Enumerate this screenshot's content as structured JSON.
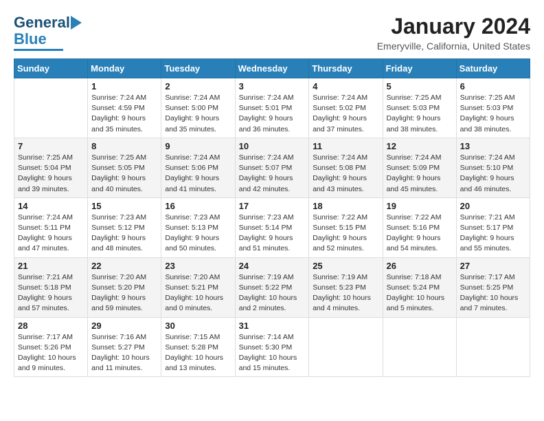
{
  "header": {
    "logo": {
      "general": "General",
      "blue": "Blue",
      "underline_color": "#2980b9"
    },
    "title": "January 2024",
    "location": "Emeryville, California, United States"
  },
  "calendar": {
    "days_of_week": [
      "Sunday",
      "Monday",
      "Tuesday",
      "Wednesday",
      "Thursday",
      "Friday",
      "Saturday"
    ],
    "weeks": [
      [
        {
          "day": "",
          "info": ""
        },
        {
          "day": "1",
          "info": "Sunrise: 7:24 AM\nSunset: 4:59 PM\nDaylight: 9 hours\nand 35 minutes."
        },
        {
          "day": "2",
          "info": "Sunrise: 7:24 AM\nSunset: 5:00 PM\nDaylight: 9 hours\nand 35 minutes."
        },
        {
          "day": "3",
          "info": "Sunrise: 7:24 AM\nSunset: 5:01 PM\nDaylight: 9 hours\nand 36 minutes."
        },
        {
          "day": "4",
          "info": "Sunrise: 7:24 AM\nSunset: 5:02 PM\nDaylight: 9 hours\nand 37 minutes."
        },
        {
          "day": "5",
          "info": "Sunrise: 7:25 AM\nSunset: 5:03 PM\nDaylight: 9 hours\nand 38 minutes."
        },
        {
          "day": "6",
          "info": "Sunrise: 7:25 AM\nSunset: 5:03 PM\nDaylight: 9 hours\nand 38 minutes."
        }
      ],
      [
        {
          "day": "7",
          "info": "Sunrise: 7:25 AM\nSunset: 5:04 PM\nDaylight: 9 hours\nand 39 minutes."
        },
        {
          "day": "8",
          "info": "Sunrise: 7:25 AM\nSunset: 5:05 PM\nDaylight: 9 hours\nand 40 minutes."
        },
        {
          "day": "9",
          "info": "Sunrise: 7:24 AM\nSunset: 5:06 PM\nDaylight: 9 hours\nand 41 minutes."
        },
        {
          "day": "10",
          "info": "Sunrise: 7:24 AM\nSunset: 5:07 PM\nDaylight: 9 hours\nand 42 minutes."
        },
        {
          "day": "11",
          "info": "Sunrise: 7:24 AM\nSunset: 5:08 PM\nDaylight: 9 hours\nand 43 minutes."
        },
        {
          "day": "12",
          "info": "Sunrise: 7:24 AM\nSunset: 5:09 PM\nDaylight: 9 hours\nand 45 minutes."
        },
        {
          "day": "13",
          "info": "Sunrise: 7:24 AM\nSunset: 5:10 PM\nDaylight: 9 hours\nand 46 minutes."
        }
      ],
      [
        {
          "day": "14",
          "info": "Sunrise: 7:24 AM\nSunset: 5:11 PM\nDaylight: 9 hours\nand 47 minutes."
        },
        {
          "day": "15",
          "info": "Sunrise: 7:23 AM\nSunset: 5:12 PM\nDaylight: 9 hours\nand 48 minutes."
        },
        {
          "day": "16",
          "info": "Sunrise: 7:23 AM\nSunset: 5:13 PM\nDaylight: 9 hours\nand 50 minutes."
        },
        {
          "day": "17",
          "info": "Sunrise: 7:23 AM\nSunset: 5:14 PM\nDaylight: 9 hours\nand 51 minutes."
        },
        {
          "day": "18",
          "info": "Sunrise: 7:22 AM\nSunset: 5:15 PM\nDaylight: 9 hours\nand 52 minutes."
        },
        {
          "day": "19",
          "info": "Sunrise: 7:22 AM\nSunset: 5:16 PM\nDaylight: 9 hours\nand 54 minutes."
        },
        {
          "day": "20",
          "info": "Sunrise: 7:21 AM\nSunset: 5:17 PM\nDaylight: 9 hours\nand 55 minutes."
        }
      ],
      [
        {
          "day": "21",
          "info": "Sunrise: 7:21 AM\nSunset: 5:18 PM\nDaylight: 9 hours\nand 57 minutes."
        },
        {
          "day": "22",
          "info": "Sunrise: 7:20 AM\nSunset: 5:20 PM\nDaylight: 9 hours\nand 59 minutes."
        },
        {
          "day": "23",
          "info": "Sunrise: 7:20 AM\nSunset: 5:21 PM\nDaylight: 10 hours\nand 0 minutes."
        },
        {
          "day": "24",
          "info": "Sunrise: 7:19 AM\nSunset: 5:22 PM\nDaylight: 10 hours\nand 2 minutes."
        },
        {
          "day": "25",
          "info": "Sunrise: 7:19 AM\nSunset: 5:23 PM\nDaylight: 10 hours\nand 4 minutes."
        },
        {
          "day": "26",
          "info": "Sunrise: 7:18 AM\nSunset: 5:24 PM\nDaylight: 10 hours\nand 5 minutes."
        },
        {
          "day": "27",
          "info": "Sunrise: 7:17 AM\nSunset: 5:25 PM\nDaylight: 10 hours\nand 7 minutes."
        }
      ],
      [
        {
          "day": "28",
          "info": "Sunrise: 7:17 AM\nSunset: 5:26 PM\nDaylight: 10 hours\nand 9 minutes."
        },
        {
          "day": "29",
          "info": "Sunrise: 7:16 AM\nSunset: 5:27 PM\nDaylight: 10 hours\nand 11 minutes."
        },
        {
          "day": "30",
          "info": "Sunrise: 7:15 AM\nSunset: 5:28 PM\nDaylight: 10 hours\nand 13 minutes."
        },
        {
          "day": "31",
          "info": "Sunrise: 7:14 AM\nSunset: 5:30 PM\nDaylight: 10 hours\nand 15 minutes."
        },
        {
          "day": "",
          "info": ""
        },
        {
          "day": "",
          "info": ""
        },
        {
          "day": "",
          "info": ""
        }
      ]
    ]
  }
}
